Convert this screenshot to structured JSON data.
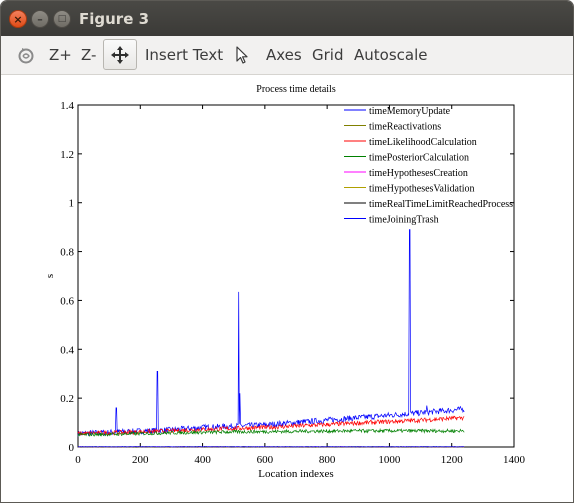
{
  "window": {
    "title": "Figure 3",
    "controls": {
      "close_glyph": "×",
      "minimize_glyph": "–",
      "maximize_glyph": "□"
    }
  },
  "toolbar": {
    "rotate_icon": "rotate-icon",
    "zoom_in_label": "Z+",
    "zoom_out_label": "Z-",
    "pan_icon": "pan-arrows-icon",
    "insert_text_label": "Insert Text",
    "pointer_icon": "pointer-icon",
    "axes_label": "Axes",
    "grid_label": "Grid",
    "autoscale_label": "Autoscale"
  },
  "chart_data": {
    "type": "line",
    "title": "Process time details",
    "xlabel": "Location indexes",
    "ylabel": "s",
    "xlim": [
      0,
      1400
    ],
    "ylim": [
      0,
      1.4
    ],
    "x_ticks": [
      "0",
      "200",
      "400",
      "600",
      "800",
      "1000",
      "1200",
      "1400"
    ],
    "y_ticks": [
      "0",
      "0.2",
      "0.4",
      "0.6",
      "0.8",
      "1",
      "1.2",
      "1.4"
    ],
    "grid": false,
    "legend_position": "top-right",
    "series": [
      {
        "name": "timeMemoryUpdate",
        "color": "#0000ff",
        "x": [
          0,
          100,
          200,
          300,
          400,
          500,
          600,
          700,
          800,
          900,
          1000,
          1100,
          1240
        ],
        "y": [
          0.055,
          0.06,
          0.065,
          0.07,
          0.08,
          0.085,
          0.09,
          0.1,
          0.11,
          0.12,
          0.13,
          0.14,
          0.155
        ],
        "spikes": [
          [
            123,
            0.16
          ],
          [
            255,
            0.31
          ],
          [
            516,
            0.635
          ],
          [
            520,
            0.22
          ],
          [
            1065,
            0.89
          ],
          [
            1120,
            0.17
          ]
        ]
      },
      {
        "name": "timeReactivations",
        "color": "#808000",
        "x": [
          0,
          1240
        ],
        "y": [
          0.001,
          0.001
        ],
        "spikes": []
      },
      {
        "name": "timeLikelihoodCalculation",
        "color": "#ff0000",
        "x": [
          0,
          100,
          200,
          300,
          400,
          500,
          600,
          700,
          800,
          900,
          1000,
          1100,
          1240
        ],
        "y": [
          0.055,
          0.058,
          0.062,
          0.066,
          0.072,
          0.076,
          0.08,
          0.086,
          0.092,
          0.098,
          0.104,
          0.11,
          0.12
        ],
        "spikes": []
      },
      {
        "name": "timePosteriorCalculation",
        "color": "#008000",
        "x": [
          0,
          100,
          200,
          300,
          400,
          500,
          600,
          700,
          800,
          900,
          1000,
          1100,
          1240
        ],
        "y": [
          0.05,
          0.052,
          0.055,
          0.058,
          0.06,
          0.062,
          0.063,
          0.064,
          0.065,
          0.066,
          0.066,
          0.066,
          0.066
        ],
        "spikes": []
      },
      {
        "name": "timeHypothesesCreation",
        "color": "#ff00ff",
        "x": [
          0,
          1240
        ],
        "y": [
          0.001,
          0.001
        ],
        "spikes": []
      },
      {
        "name": "timeHypothesesValidation",
        "color": "#b0a000",
        "x": [
          0,
          1240
        ],
        "y": [
          0.001,
          0.001
        ],
        "spikes": []
      },
      {
        "name": "timeRealTimeLimitReachedProcess",
        "color": "#000000",
        "x": [
          0,
          1240
        ],
        "y": [
          0.001,
          0.001
        ],
        "spikes": []
      },
      {
        "name": "timeJoiningTrash",
        "color": "#0000ff",
        "x": [
          0,
          1240
        ],
        "y": [
          0.001,
          0.001
        ],
        "spikes": []
      }
    ]
  }
}
